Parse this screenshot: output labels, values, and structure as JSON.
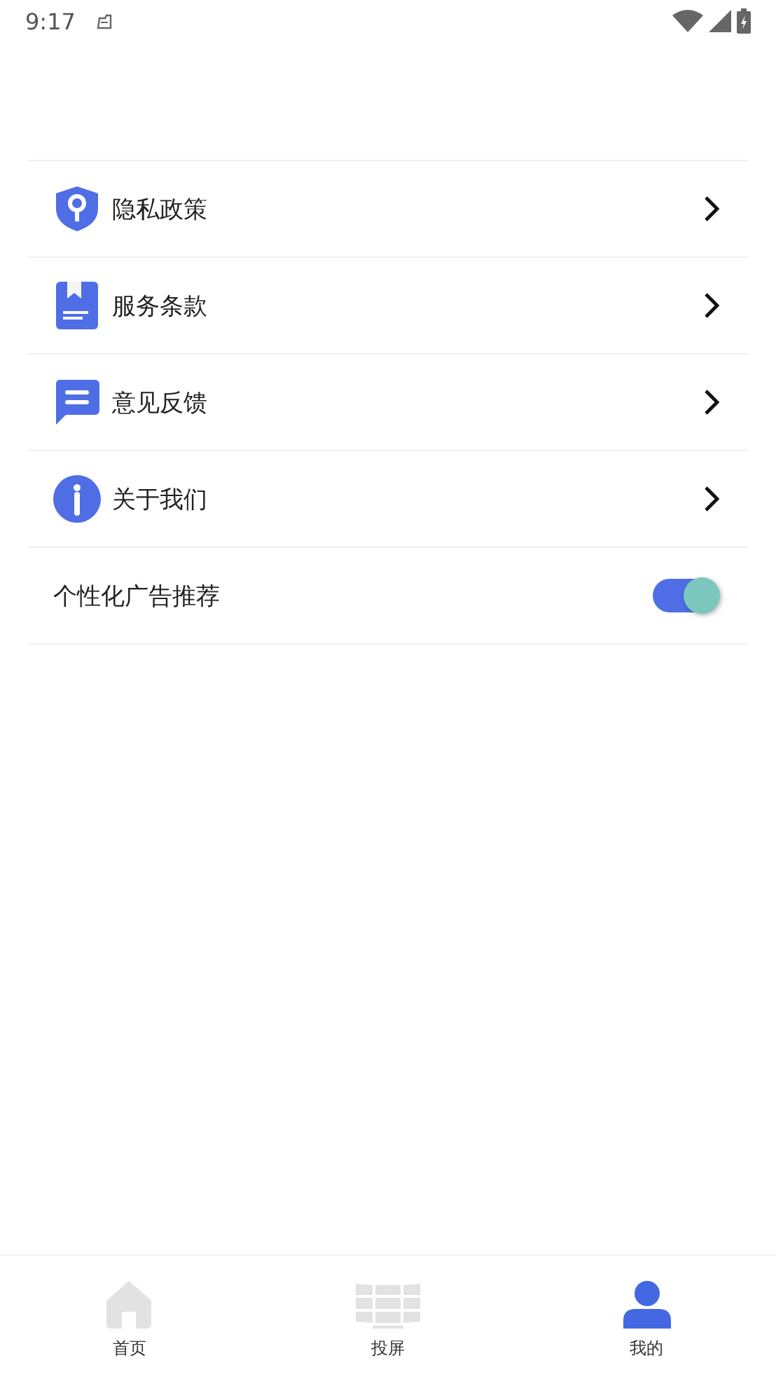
{
  "status_bar": {
    "time": "9:17"
  },
  "menu": [
    {
      "kind": "link",
      "label": "隐私政策"
    },
    {
      "kind": "link",
      "label": "服务条款"
    },
    {
      "kind": "link",
      "label": "意见反馈"
    },
    {
      "kind": "link",
      "label": "关于我们"
    },
    {
      "kind": "toggle",
      "label": "个性化广告推荐",
      "on": true
    }
  ],
  "bottom_nav": [
    {
      "label": "首页",
      "selected": false
    },
    {
      "label": "投屏",
      "selected": false
    },
    {
      "label": "我的",
      "selected": true
    }
  ]
}
